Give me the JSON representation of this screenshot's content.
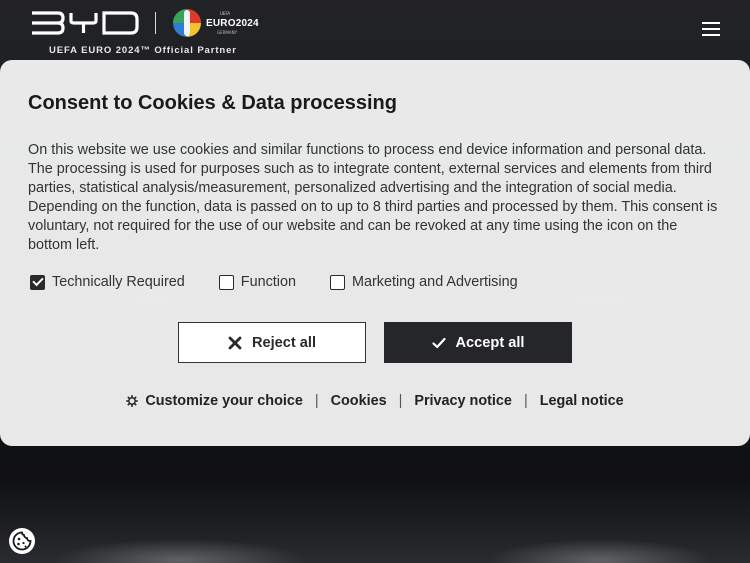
{
  "header": {
    "brand": "BYD",
    "euro_title": "EURO2024",
    "euro_uefa": "UEFA",
    "euro_sub": "GERMANY",
    "partner": "UEFA EURO 2024™ Official Partner",
    "menu_icon": "hamburger-icon"
  },
  "consent": {
    "title": "Consent to Cookies & Data processing",
    "body": "On this website we use cookies and similar functions to process end device information and personal data. The processing is used for purposes such as to integrate content, external services and elements from third parties, statistical analysis/measurement, personalized advertising and the integration of social media. Depending on the function, data is passed on to up to 8 third parties and processed by them. This consent is voluntary, not required for the use of our website and can be revoked at any time using the icon on the bottom left.",
    "options": [
      {
        "label": "Technically Required",
        "checked": true
      },
      {
        "label": "Function",
        "checked": false
      },
      {
        "label": "Marketing and Advertising",
        "checked": false
      }
    ],
    "reject_label": "Reject all",
    "accept_label": "Accept all",
    "links": {
      "customize": "Customize your choice",
      "cookies": "Cookies",
      "privacy": "Privacy notice",
      "legal": "Legal notice",
      "separator": "|"
    }
  },
  "colors": {
    "accent_dark": "#25262a",
    "modal_bg": "#f0f0f0"
  }
}
